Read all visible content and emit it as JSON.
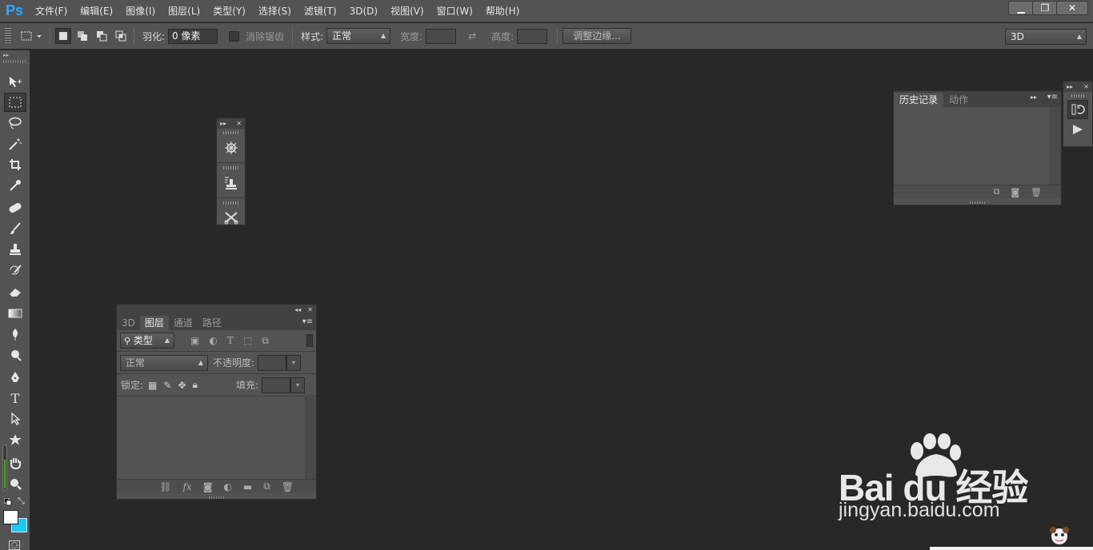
{
  "app": {
    "logo": "Ps"
  },
  "menu": [
    "文件(F)",
    "编辑(E)",
    "图像(I)",
    "图层(L)",
    "类型(Y)",
    "选择(S)",
    "滤镜(T)",
    "3D(D)",
    "视图(V)",
    "窗口(W)",
    "帮助(H)"
  ],
  "window_controls": {
    "minimize": "▁",
    "restore": "❐",
    "close": "✕"
  },
  "options": {
    "feather_label": "羽化:",
    "feather_value": "0 像素",
    "antialias_label": "消除锯齿",
    "style_label": "样式:",
    "style_value": "正常",
    "width_label": "宽度:",
    "height_label": "高度:",
    "refine_edge": "调整边缘...",
    "workspace": "3D"
  },
  "tools": [
    "move-tool",
    "marquee-tool",
    "lasso-tool",
    "magic-wand-tool",
    "crop-tool",
    "eyedropper-tool",
    "healing-brush-tool",
    "brush-tool",
    "clone-stamp-tool",
    "history-brush-tool",
    "eraser-tool",
    "gradient-tool",
    "blur-tool",
    "dodge-tool",
    "pen-tool",
    "type-tool",
    "path-selection-tool",
    "shape-tool",
    "hand-tool",
    "zoom-tool"
  ],
  "colors": {
    "foreground": "#ffffff",
    "background": "#1ec8ef",
    "accent": "#31a8ff"
  },
  "history_panel": {
    "tabs": [
      "历史记录",
      "动作"
    ],
    "active": "历史记录"
  },
  "layers_panel": {
    "tabs": [
      "3D",
      "图层",
      "通道",
      "路径"
    ],
    "active": "图层",
    "filter_kind": "类型",
    "blend_mode": "正常",
    "opacity_label": "不透明度:",
    "lock_label": "锁定:",
    "fill_label": "填充:",
    "footer_fx": "fx"
  },
  "watermark": {
    "brand": "Bai du 经验",
    "url": "jingyan.baidu.com"
  }
}
